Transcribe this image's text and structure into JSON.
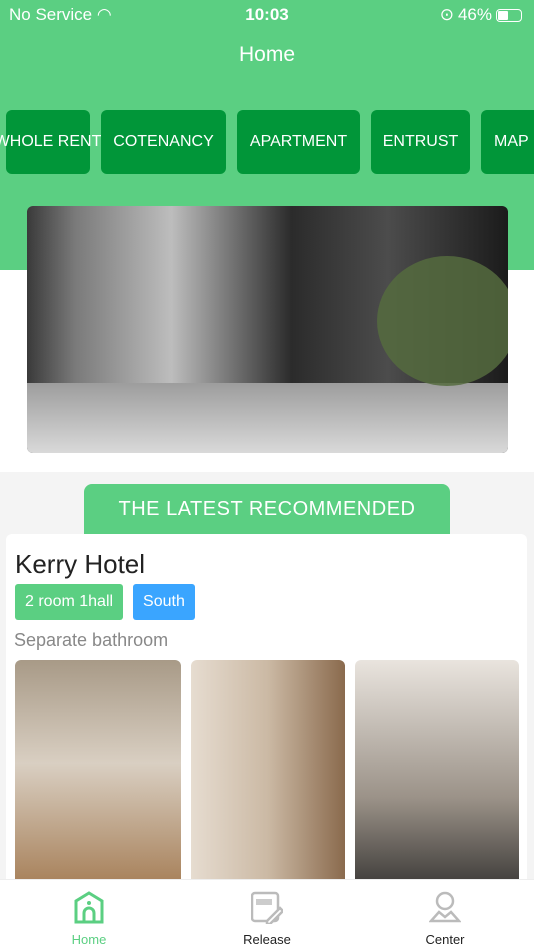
{
  "status_bar": {
    "carrier": "No Service",
    "time": "10:03",
    "battery": "46%",
    "battery_level": 0.46
  },
  "header": {
    "title": "Home"
  },
  "categories": [
    "WHOLE RENT",
    "COTENANCY",
    "APARTMENT",
    "ENTRUST",
    "MAP"
  ],
  "section_title": "THE LATEST RECOMMENDED",
  "listing": {
    "name": "Kerry Hotel",
    "tags": [
      {
        "label": "2 room 1hall",
        "color": "#5bcf82"
      },
      {
        "label": "South",
        "color": "#3aa5ff"
      }
    ],
    "description": "Separate bathroom"
  },
  "tabbar": {
    "items": [
      {
        "label": "Home",
        "icon": "home-icon",
        "active": true
      },
      {
        "label": "Release",
        "icon": "edit-icon"
      },
      {
        "label": "Center",
        "icon": "user-icon"
      }
    ]
  },
  "colors": {
    "primary": "#5bcf82",
    "button": "#019639",
    "blue": "#3aa5ff"
  }
}
